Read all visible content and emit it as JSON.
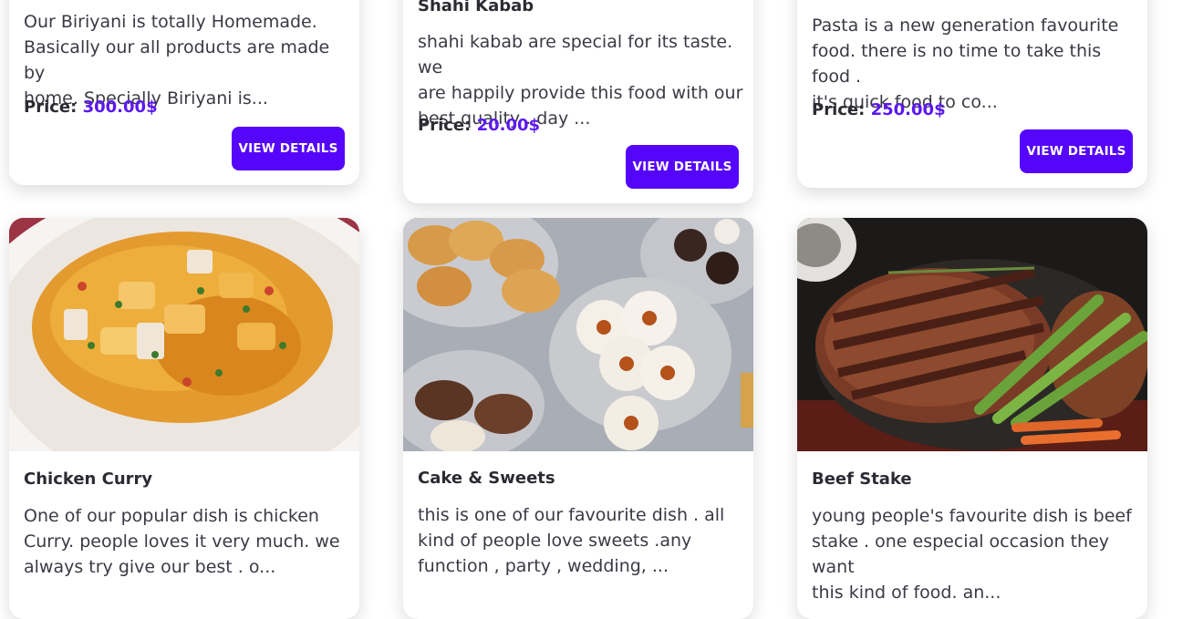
{
  "price_label": "Price:",
  "view_details_label": "VIEW DETAILS",
  "top_cards": [
    {
      "title": "",
      "description_lines": [
        "Our Biriyani is totally Homemade.",
        "Basically our all products are made by",
        "home. Specially Biriyani is..."
      ],
      "price": "300.00$"
    },
    {
      "title": "Shahi Kabab",
      "description_lines": [
        "shahi kabab are special for its taste. we",
        "are happily provide this food with our",
        "best quality . day ..."
      ],
      "price": "20.00$"
    },
    {
      "title": "",
      "description_lines": [
        "Pasta is a new generation favourite",
        "food. there is no time to take this food .",
        "it's quick food to co..."
      ],
      "price": "250.00$"
    }
  ],
  "bottom_cards": [
    {
      "title": "Chicken Curry",
      "image_alt": "Chicken curry dish",
      "description_lines": [
        "One of our popular dish is chicken",
        "Curry. people loves it very much. we",
        "always try give our best . o..."
      ]
    },
    {
      "title": "Cake & Sweets",
      "image_alt": "Cookies and sweets platter",
      "description_lines": [
        "this is one of our favourite dish . all",
        "kind of people love sweets .any",
        "function , party , wedding, ..."
      ]
    },
    {
      "title": "Beef Stake",
      "image_alt": "Grilled beef steak with asparagus",
      "description_lines": [
        "young people's favourite dish is beef",
        "stake . one especial occasion they want",
        "this kind of food. an..."
      ]
    }
  ],
  "colors": {
    "accent": "#5506fa",
    "price": "#5b18f0"
  }
}
